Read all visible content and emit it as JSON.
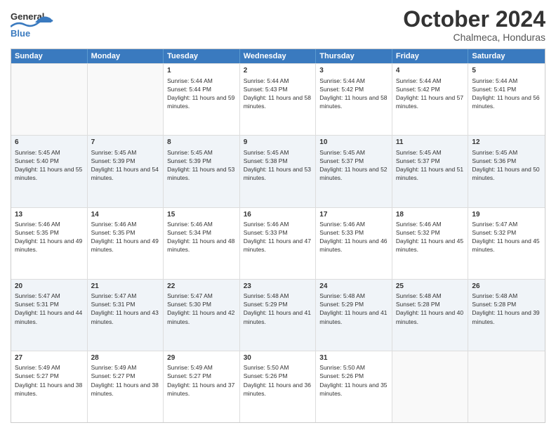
{
  "header": {
    "logo_line1": "General",
    "logo_line2": "Blue",
    "month": "October 2024",
    "location": "Chalmeca, Honduras"
  },
  "days": [
    "Sunday",
    "Monday",
    "Tuesday",
    "Wednesday",
    "Thursday",
    "Friday",
    "Saturday"
  ],
  "rows": [
    [
      {
        "day": "",
        "empty": true
      },
      {
        "day": "",
        "empty": true
      },
      {
        "day": "1",
        "sunrise": "5:44 AM",
        "sunset": "5:44 PM",
        "daylight": "11 hours and 59 minutes."
      },
      {
        "day": "2",
        "sunrise": "5:44 AM",
        "sunset": "5:43 PM",
        "daylight": "11 hours and 58 minutes."
      },
      {
        "day": "3",
        "sunrise": "5:44 AM",
        "sunset": "5:42 PM",
        "daylight": "11 hours and 58 minutes."
      },
      {
        "day": "4",
        "sunrise": "5:44 AM",
        "sunset": "5:42 PM",
        "daylight": "11 hours and 57 minutes."
      },
      {
        "day": "5",
        "sunrise": "5:44 AM",
        "sunset": "5:41 PM",
        "daylight": "11 hours and 56 minutes."
      }
    ],
    [
      {
        "day": "6",
        "sunrise": "5:45 AM",
        "sunset": "5:40 PM",
        "daylight": "11 hours and 55 minutes."
      },
      {
        "day": "7",
        "sunrise": "5:45 AM",
        "sunset": "5:39 PM",
        "daylight": "11 hours and 54 minutes."
      },
      {
        "day": "8",
        "sunrise": "5:45 AM",
        "sunset": "5:39 PM",
        "daylight": "11 hours and 53 minutes."
      },
      {
        "day": "9",
        "sunrise": "5:45 AM",
        "sunset": "5:38 PM",
        "daylight": "11 hours and 53 minutes."
      },
      {
        "day": "10",
        "sunrise": "5:45 AM",
        "sunset": "5:37 PM",
        "daylight": "11 hours and 52 minutes."
      },
      {
        "day": "11",
        "sunrise": "5:45 AM",
        "sunset": "5:37 PM",
        "daylight": "11 hours and 51 minutes."
      },
      {
        "day": "12",
        "sunrise": "5:45 AM",
        "sunset": "5:36 PM",
        "daylight": "11 hours and 50 minutes."
      }
    ],
    [
      {
        "day": "13",
        "sunrise": "5:46 AM",
        "sunset": "5:35 PM",
        "daylight": "11 hours and 49 minutes."
      },
      {
        "day": "14",
        "sunrise": "5:46 AM",
        "sunset": "5:35 PM",
        "daylight": "11 hours and 49 minutes."
      },
      {
        "day": "15",
        "sunrise": "5:46 AM",
        "sunset": "5:34 PM",
        "daylight": "11 hours and 48 minutes."
      },
      {
        "day": "16",
        "sunrise": "5:46 AM",
        "sunset": "5:33 PM",
        "daylight": "11 hours and 47 minutes."
      },
      {
        "day": "17",
        "sunrise": "5:46 AM",
        "sunset": "5:33 PM",
        "daylight": "11 hours and 46 minutes."
      },
      {
        "day": "18",
        "sunrise": "5:46 AM",
        "sunset": "5:32 PM",
        "daylight": "11 hours and 45 minutes."
      },
      {
        "day": "19",
        "sunrise": "5:47 AM",
        "sunset": "5:32 PM",
        "daylight": "11 hours and 45 minutes."
      }
    ],
    [
      {
        "day": "20",
        "sunrise": "5:47 AM",
        "sunset": "5:31 PM",
        "daylight": "11 hours and 44 minutes."
      },
      {
        "day": "21",
        "sunrise": "5:47 AM",
        "sunset": "5:31 PM",
        "daylight": "11 hours and 43 minutes."
      },
      {
        "day": "22",
        "sunrise": "5:47 AM",
        "sunset": "5:30 PM",
        "daylight": "11 hours and 42 minutes."
      },
      {
        "day": "23",
        "sunrise": "5:48 AM",
        "sunset": "5:29 PM",
        "daylight": "11 hours and 41 minutes."
      },
      {
        "day": "24",
        "sunrise": "5:48 AM",
        "sunset": "5:29 PM",
        "daylight": "11 hours and 41 minutes."
      },
      {
        "day": "25",
        "sunrise": "5:48 AM",
        "sunset": "5:28 PM",
        "daylight": "11 hours and 40 minutes."
      },
      {
        "day": "26",
        "sunrise": "5:48 AM",
        "sunset": "5:28 PM",
        "daylight": "11 hours and 39 minutes."
      }
    ],
    [
      {
        "day": "27",
        "sunrise": "5:49 AM",
        "sunset": "5:27 PM",
        "daylight": "11 hours and 38 minutes."
      },
      {
        "day": "28",
        "sunrise": "5:49 AM",
        "sunset": "5:27 PM",
        "daylight": "11 hours and 38 minutes."
      },
      {
        "day": "29",
        "sunrise": "5:49 AM",
        "sunset": "5:27 PM",
        "daylight": "11 hours and 37 minutes."
      },
      {
        "day": "30",
        "sunrise": "5:50 AM",
        "sunset": "5:26 PM",
        "daylight": "11 hours and 36 minutes."
      },
      {
        "day": "31",
        "sunrise": "5:50 AM",
        "sunset": "5:26 PM",
        "daylight": "11 hours and 35 minutes."
      },
      {
        "day": "",
        "empty": true
      },
      {
        "day": "",
        "empty": true
      }
    ]
  ],
  "labels": {
    "sunrise": "Sunrise:",
    "sunset": "Sunset:",
    "daylight": "Daylight:"
  }
}
